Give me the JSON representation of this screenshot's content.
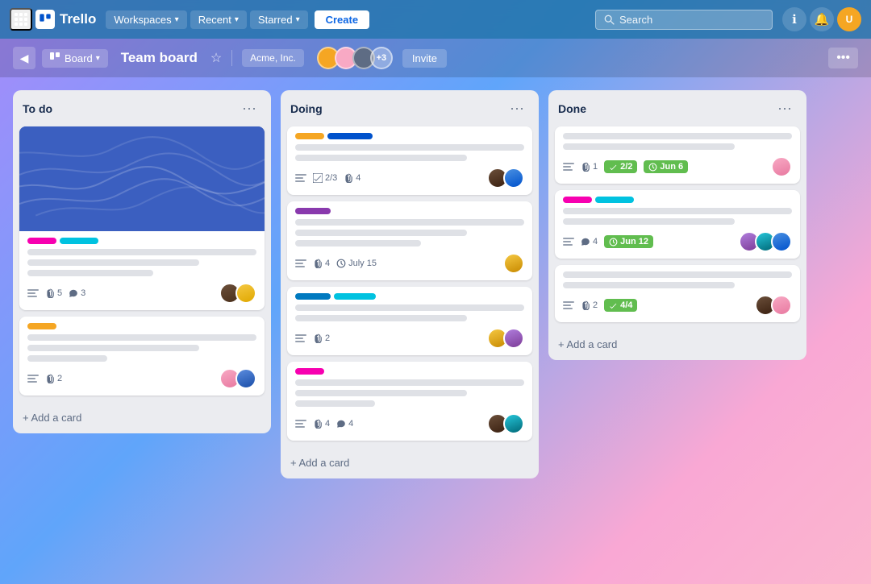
{
  "nav": {
    "logo": "Trello",
    "workspaces": "Workspaces",
    "recent": "Recent",
    "starred": "Starred",
    "create": "Create",
    "search_placeholder": "Search"
  },
  "subheader": {
    "board_view": "Board",
    "board_title": "Team board",
    "workspace_name": "Acme, Inc.",
    "member_count": "+3",
    "invite": "Invite",
    "more": "•••"
  },
  "columns": [
    {
      "id": "todo",
      "title": "To do",
      "add_card": "+ Add a card",
      "cards": [
        {
          "id": "todo-1",
          "has_cover": true,
          "labels": [
            "pink",
            "cyan"
          ],
          "lines": [
            "full",
            "medium",
            "short"
          ],
          "footer": {
            "icons": [
              {
                "type": "attach",
                "count": "5"
              },
              {
                "type": "comment",
                "count": "3"
              }
            ],
            "avatars": [
              "dark",
              "yellow"
            ]
          }
        },
        {
          "id": "todo-2",
          "has_cover": false,
          "labels": [
            "yellow"
          ],
          "lines": [
            "full",
            "medium",
            "xshort"
          ],
          "footer": {
            "icons": [
              {
                "type": "attach",
                "count": "2"
              }
            ],
            "avatars": [
              "pink",
              "blue"
            ]
          }
        }
      ]
    },
    {
      "id": "doing",
      "title": "Doing",
      "add_card": "+ Add a card",
      "cards": [
        {
          "id": "doing-1",
          "has_cover": false,
          "labels": [
            "yellow",
            "blue2"
          ],
          "lines": [
            "full",
            "medium"
          ],
          "footer": {
            "icons": [
              {
                "type": "checklist",
                "count": "2/3"
              },
              {
                "type": "attach",
                "count": "4"
              }
            ],
            "avatars": [
              "dark",
              "blue"
            ]
          }
        },
        {
          "id": "doing-2",
          "has_cover": false,
          "labels": [
            "purple"
          ],
          "lines": [
            "full",
            "medium",
            "short"
          ],
          "footer": {
            "icons": [
              {
                "type": "attach",
                "count": "4"
              },
              {
                "type": "clock",
                "count": "July 15"
              }
            ],
            "avatars": [
              "yellow"
            ]
          }
        },
        {
          "id": "doing-3",
          "has_cover": false,
          "labels": [
            "blue",
            "teal"
          ],
          "lines": [
            "full",
            "medium"
          ],
          "footer": {
            "icons": [
              {
                "type": "attach",
                "count": "2"
              }
            ],
            "avatars": [
              "yellow",
              "purple"
            ]
          }
        },
        {
          "id": "doing-4",
          "has_cover": false,
          "labels": [
            "pink"
          ],
          "lines": [
            "full",
            "medium",
            "xshort"
          ],
          "footer": {
            "icons": [
              {
                "type": "attach",
                "count": "4"
              },
              {
                "type": "comment",
                "count": "4"
              }
            ],
            "avatars": [
              "dark",
              "teal"
            ]
          }
        }
      ]
    },
    {
      "id": "done",
      "title": "Done",
      "add_card": "+ Add a card",
      "cards": [
        {
          "id": "done-1",
          "has_cover": false,
          "labels": [],
          "lines": [
            "full",
            "medium"
          ],
          "footer": {
            "icons": [
              {
                "type": "attach",
                "count": "1"
              },
              {
                "type": "badge-check",
                "count": "2/2"
              },
              {
                "type": "badge-date",
                "count": "Jun 6"
              }
            ],
            "avatars": [
              "pink"
            ]
          }
        },
        {
          "id": "done-2",
          "has_cover": false,
          "labels": [
            "pink",
            "cyan"
          ],
          "lines": [
            "full",
            "medium"
          ],
          "footer": {
            "icons": [
              {
                "type": "comment",
                "count": "4"
              },
              {
                "type": "badge-date",
                "count": "Jun 12"
              }
            ],
            "avatars": [
              "purple",
              "teal",
              "blue"
            ]
          }
        },
        {
          "id": "done-3",
          "has_cover": false,
          "labels": [],
          "lines": [
            "full",
            "medium"
          ],
          "footer": {
            "icons": [
              {
                "type": "attach",
                "count": "2"
              },
              {
                "type": "badge-check",
                "count": "4/4"
              }
            ],
            "avatars": [
              "dark",
              "pink"
            ]
          }
        }
      ]
    }
  ]
}
